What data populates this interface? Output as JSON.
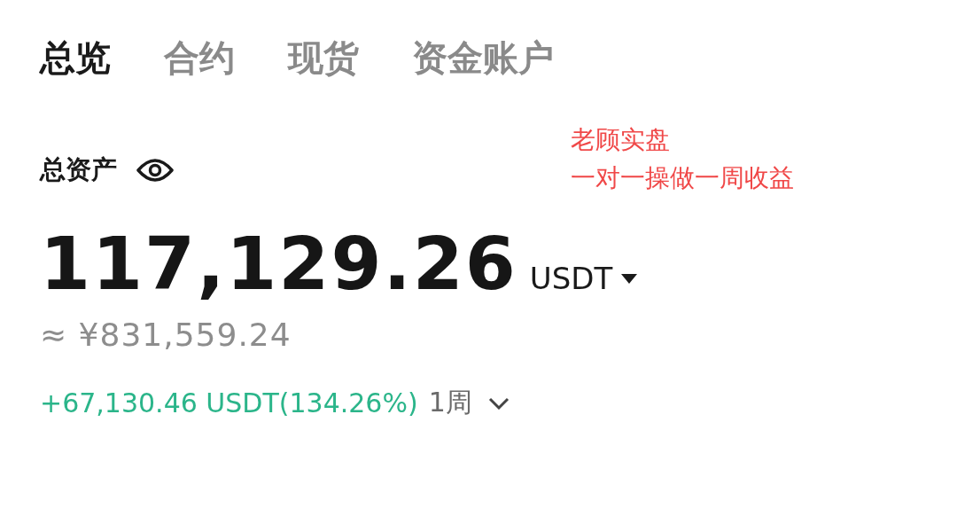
{
  "tabs": [
    {
      "label": "总览",
      "selected": true
    },
    {
      "label": "合约",
      "selected": false
    },
    {
      "label": "现货",
      "selected": false
    },
    {
      "label": "资金账户",
      "selected": false
    }
  ],
  "total_assets": {
    "label": "总资产",
    "balance": "117,129.26",
    "currency": "USDT",
    "fiat_value": "≈ ¥831,559.24",
    "pnl": "+67,130.46 USDT(134.26%)",
    "period": "1周"
  },
  "annotation": [
    "老顾实盘",
    "一对一操做一周收益"
  ]
}
